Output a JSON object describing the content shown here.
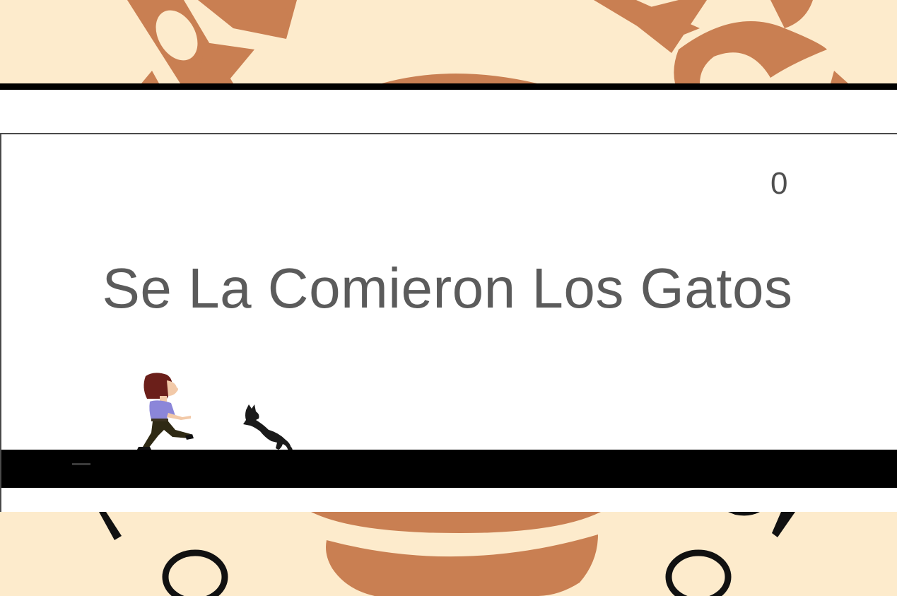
{
  "game": {
    "title": "Se La Comieron Los Gatos",
    "score": "0"
  },
  "colors": {
    "background_pattern": "#fdebcc",
    "pattern_accent": "#c97f52",
    "ground": "#000000",
    "text": "#5b5b5b"
  },
  "sprites": {
    "player": "running-girl",
    "enemy": "black-cat"
  }
}
